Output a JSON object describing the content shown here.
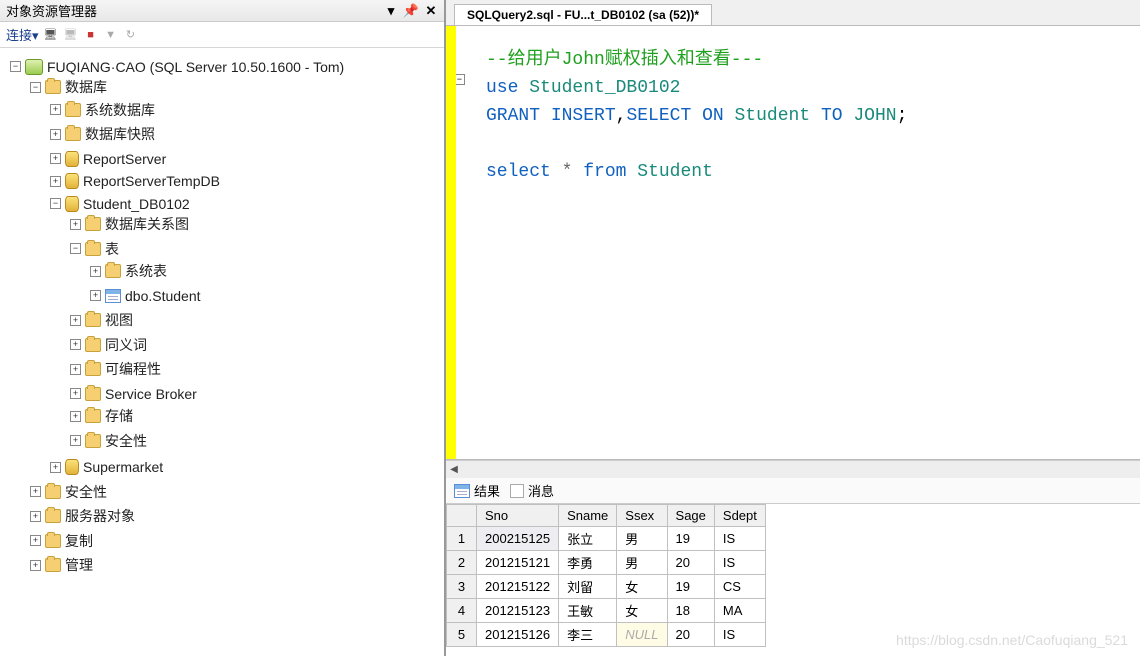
{
  "panel": {
    "title": "对象资源管理器"
  },
  "toolbar": {
    "connect_label": "连接▾"
  },
  "tree": {
    "server": "FUQIANG·CAO (SQL Server 10.50.1600 - Tom)",
    "databases": "数据库",
    "system_db": "系统数据库",
    "db_snapshots": "数据库快照",
    "reportserver": "ReportServer",
    "reportservertemp": "ReportServerTempDB",
    "student_db": "Student_DB0102",
    "db_diagrams": "数据库关系图",
    "tables": "表",
    "system_tables": "系统表",
    "dbo_student": "dbo.Student",
    "views": "视图",
    "synonyms": "同义词",
    "programmability": "可编程性",
    "service_broker": "Service Broker",
    "storage": "存储",
    "security_db": "安全性",
    "supermarket": "Supermarket",
    "security": "安全性",
    "server_objects": "服务器对象",
    "replication": "复制",
    "management": "管理"
  },
  "tab": {
    "label": "SQLQuery2.sql - FU...t_DB0102 (sa (52))*"
  },
  "sql": {
    "line1": "--给用户John赋权插入和查看---",
    "use_kw": "use",
    "use_db": "Student_DB0102",
    "grant_kw": "GRANT",
    "insert_kw": "INSERT",
    "comma": ",",
    "select_kw1": "SELECT",
    "on_kw": "ON",
    "student1": "Student",
    "to_kw": "TO",
    "john": "JOHN",
    "semi": ";",
    "select_kw2": "select",
    "star": "*",
    "from_kw": "from",
    "student2": "Student"
  },
  "results_tabs": {
    "results": "结果",
    "messages": "消息"
  },
  "grid": {
    "headers": [
      "Sno",
      "Sname",
      "Ssex",
      "Sage",
      "Sdept"
    ],
    "rows": [
      {
        "n": "1",
        "Sno": "200215125",
        "Sname": "张立",
        "Ssex": "男",
        "Sage": "19",
        "Sdept": "IS"
      },
      {
        "n": "2",
        "Sno": "201215121",
        "Sname": "李勇",
        "Ssex": "男",
        "Sage": "20",
        "Sdept": "IS"
      },
      {
        "n": "3",
        "Sno": "201215122",
        "Sname": "刘留",
        "Ssex": "女",
        "Sage": "19",
        "Sdept": "CS"
      },
      {
        "n": "4",
        "Sno": "201215123",
        "Sname": "王敏",
        "Ssex": "女",
        "Sage": "18",
        "Sdept": "MA"
      },
      {
        "n": "5",
        "Sno": "201215126",
        "Sname": "李三",
        "Ssex": "NULL",
        "Sage": "20",
        "Sdept": "IS"
      }
    ]
  },
  "watermark": "https://blog.csdn.net/Caofuqiang_521"
}
